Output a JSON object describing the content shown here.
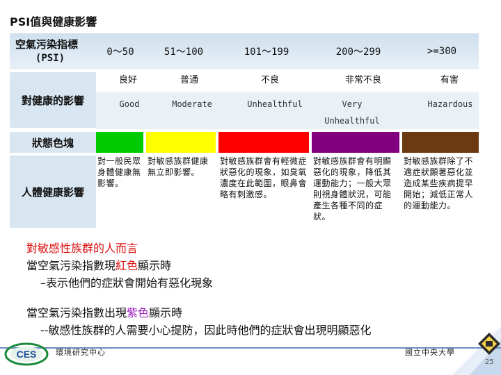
{
  "title": "PSI值與健康影響",
  "table": {
    "header_title": "空氣污染指標",
    "header_sub": "(PSI)",
    "ranges": [
      "0～50",
      "51～100",
      "101～199",
      "200～299",
      ">=300"
    ],
    "row_health_label": "對健康的影響",
    "health_zh": [
      "良好",
      "普通",
      "不良",
      "非常不良",
      "有害"
    ],
    "health_en": [
      "Good",
      "Moderate",
      "Unhealthful",
      "Very Unhealthful",
      "Hazardous"
    ],
    "row_color_label": "狀態色塊",
    "colors": [
      "#00cc00",
      "#ffff00",
      "#ff0000",
      "#800080",
      "#6b3a10"
    ],
    "row_effect_label": "人體健康影響",
    "effects": [
      "對一般民眾身體健康無影響。",
      "對敏感族群健康無立即影響。",
      "對敏感族群會有輕微症狀惡化的現象，如臭氧濃度在此範圍，眼鼻會略有刺激感。",
      "對敏感族群會有明顯惡化的現象，降低其運動能力；一般大眾則視身體狀況，可能產生各種不同的症狀。",
      "對敏感族群除了不適症狀顯著惡化並造成某些疾病提早開始；減低正常人的運動能力。"
    ]
  },
  "notes": {
    "line1": "對敏感性族群的人而言",
    "line2_prefix": "當空氣污染指數現",
    "line2_highlight": "紅色",
    "line2_suffix": "顯示時",
    "line3": "–表示他們的症狀會開始有惡化現象",
    "line4_prefix": "當空氣污染指數出現",
    "line4_highlight": "紫色",
    "line4_suffix": "顯示時",
    "line5": "--敏感性族群的人需要小心提防，因此時他們的症狀會出現明顯惡化"
  },
  "footer": {
    "logo_text": "CES",
    "center_name": "環境研究中心",
    "university": "國立中央大學",
    "page_number": "25"
  },
  "accent_colors": {
    "red": "#dd1111",
    "purple": "#a020c0",
    "header_blue": "#d8e6f1"
  }
}
